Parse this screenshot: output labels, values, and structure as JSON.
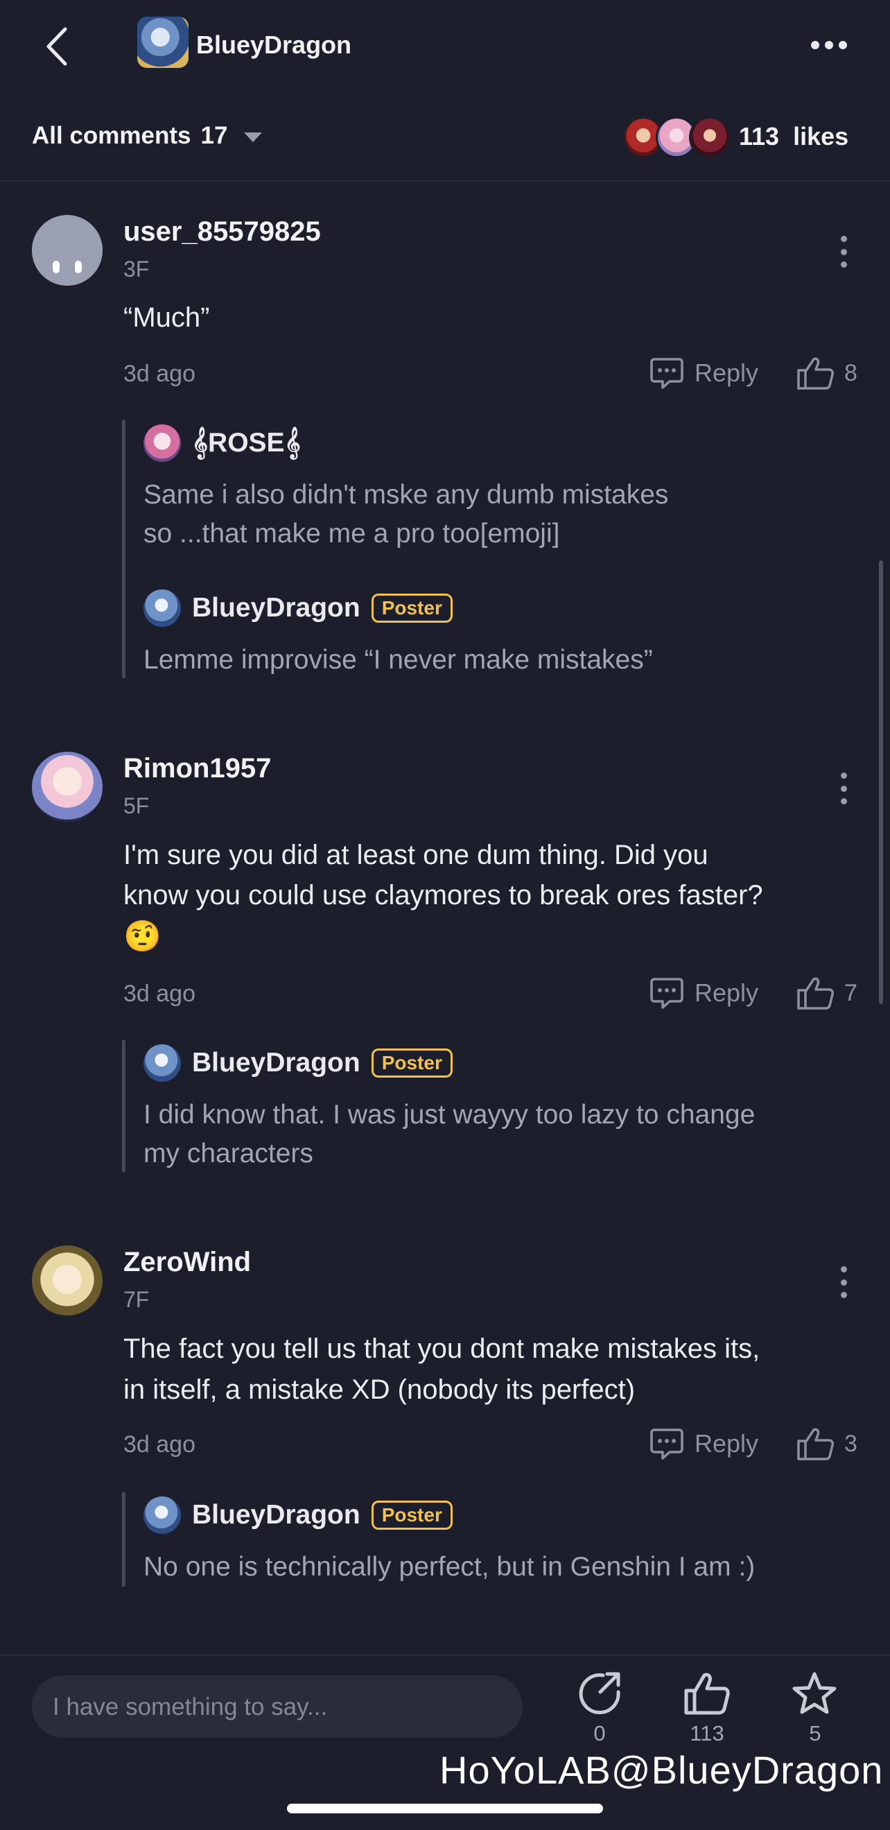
{
  "header": {
    "title": "BlueyDragon"
  },
  "filter": {
    "label": "All comments",
    "count": "17"
  },
  "likes": {
    "count": "113",
    "label": "likes"
  },
  "comments": [
    {
      "username": "user_85579825",
      "floor": "3F",
      "text": "“Much”",
      "time": "3d ago",
      "reply_label": "Reply",
      "likes": "8",
      "replies": [
        {
          "username": "𝄞ROSE𝄞",
          "badge": "",
          "text_lines": [
            "Same i also didn't mske any dumb mistakes",
            "so ...that make me a pro too[emoji]"
          ]
        },
        {
          "username": "BlueyDragon",
          "badge": "Poster",
          "text_lines": [
            "Lemme improvise “I never make mistakes”"
          ]
        }
      ]
    },
    {
      "username": "Rimon1957",
      "floor": "5F",
      "text_lines": [
        "I'm sure you did at least one dum thing. Did you",
        "know you could use claymores to break ores faster?"
      ],
      "emoji": "🤨",
      "time": "3d ago",
      "reply_label": "Reply",
      "likes": "7",
      "replies": [
        {
          "username": "BlueyDragon",
          "badge": "Poster",
          "text_lines": [
            "I did know that. I was just wayyy too lazy to change",
            "my characters"
          ]
        }
      ]
    },
    {
      "username": "ZeroWind",
      "floor": "7F",
      "text_lines": [
        "The fact you tell us that you dont make mistakes its,",
        "in itself, a mistake XD (nobody its perfect)"
      ],
      "time": "3d ago",
      "reply_label": "Reply",
      "likes": "3",
      "replies": [
        {
          "username": "BlueyDragon",
          "badge": "Poster",
          "text_lines": [
            "No one is technically perfect, but in Genshin I am :)"
          ]
        }
      ]
    }
  ],
  "bottom": {
    "input_placeholder": "I have something to say...",
    "share_count": "0",
    "like_count": "113",
    "fav_count": "5"
  },
  "watermark": "HoYoLAB@BlueyDragon"
}
